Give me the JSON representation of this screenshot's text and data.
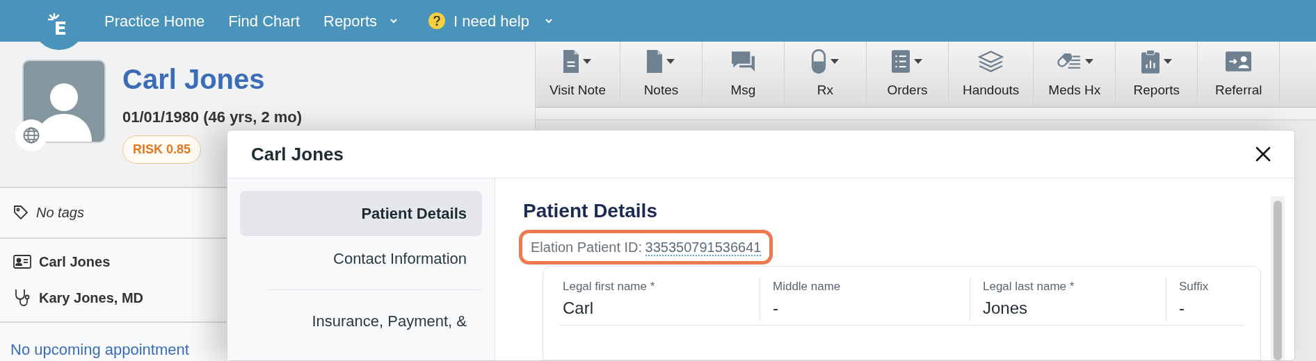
{
  "nav": [
    {
      "label": "Practice Home",
      "kind": "link"
    },
    {
      "label": "Find Chart",
      "kind": "link"
    },
    {
      "label": "Reports",
      "kind": "dropdown"
    },
    {
      "label": "I need help",
      "kind": "help"
    }
  ],
  "patient": {
    "name": "Carl Jones",
    "dob": "01/01/1980 (46 yrs, 2 mo)",
    "risk": "RISK 0.85"
  },
  "tags": "No tags",
  "contacts": [
    {
      "kind": "patient",
      "text": "Carl Jones"
    },
    {
      "kind": "provider",
      "text": "Kary Jones, MD"
    }
  ],
  "appointments": "No upcoming appointment",
  "toolbar": [
    {
      "label": "Visit Note",
      "kind": "note",
      "dropdown": true
    },
    {
      "label": "Notes",
      "kind": "page",
      "dropdown": true
    },
    {
      "label": "Msg",
      "kind": "chat",
      "dropdown": false
    },
    {
      "label": "Rx",
      "kind": "capsule",
      "dropdown": true
    },
    {
      "label": "Orders",
      "kind": "list",
      "dropdown": true
    },
    {
      "label": "Handouts",
      "kind": "stack",
      "dropdown": false
    },
    {
      "label": "Meds Hx",
      "kind": "pill",
      "dropdown": true
    },
    {
      "label": "Reports",
      "kind": "clipboard",
      "dropdown": true
    },
    {
      "label": "Referral",
      "kind": "card",
      "dropdown": false
    }
  ],
  "modal": {
    "title": "Carl Jones",
    "sidebar": [
      {
        "label": "Patient Details",
        "selected": true
      },
      {
        "label": "Contact Information",
        "selected": false
      },
      {
        "label": "Insurance, Payment, &",
        "selected": false
      }
    ],
    "heading": "Patient Details",
    "id_label": "Elation Patient ID:",
    "id_value": "335350791536641",
    "id_highlighted": true,
    "fields": [
      {
        "label": "Legal first name *",
        "value": "Carl"
      },
      {
        "label": "Middle name",
        "value": "-"
      },
      {
        "label": "Legal last name *",
        "value": "Jones"
      },
      {
        "label": "Suffix",
        "value": "-"
      }
    ]
  }
}
